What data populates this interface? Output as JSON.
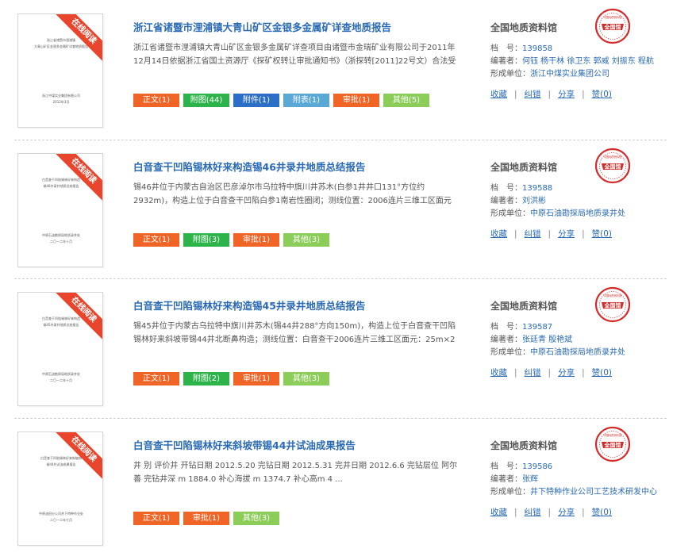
{
  "records": [
    {
      "title": "浙江省诸暨市浬浦镇大青山矿区金银多金属矿详查地质报告",
      "summary": "浙江省诸暨市浬浦镇大青山矿区金银多金属矿详查项目由诸暨市金瑞矿业有限公司于2011年12月14日依据浙江省国土资源厅《探矿权转让审批通知书》（浙探转[2011]22号文）合法受让，勘查单位为浙江中 ...",
      "ribbon": "在线阅读",
      "thumb_lines": [
        "浙江省诸暨市浬浦镇",
        "大青山矿区金银多金属矿详查地质报告"
      ],
      "thumb_footer": [
        "浙江中煤实业集团有限公司",
        "2012年3月"
      ],
      "tags": [
        {
          "label": "正文(1)",
          "color": "#f06525"
        },
        {
          "label": "附图(44)",
          "color": "#2cb34a"
        },
        {
          "label": "附件(1)",
          "color": "#2c6fc6"
        },
        {
          "label": "附表(1)",
          "color": "#5aa8d6"
        },
        {
          "label": "审批(1)",
          "color": "#f06525"
        },
        {
          "label": "其他(5)",
          "color": "#8ccd5a"
        }
      ],
      "org": "全国地质资料馆",
      "archive_label": "档　号：",
      "archive_no": "139858",
      "authors_label": "编著者：",
      "authors": "何钰 杨干林 徐卫东 郭威 刘振东 程航",
      "unit_label": "形成单位：",
      "unit": "浙江中煤实业集团公司",
      "actions": [
        "收藏",
        "纠错",
        "分享",
        "赞(0)"
      ]
    },
    {
      "title": "白音查干凹陷锡林好来构造锡46井录井地质总结报告",
      "summary": "锡46井位于内蒙古自治区巴彦淖尔市乌拉特中旗川井苏木(白参1井井口131°方位约2932m)，构造上位于白音查干凹陷白参1南岩性圈闭；测线位置：2006连片三维工区面元25m×25 ...",
      "ribbon": "在线阅读",
      "thumb_lines": [
        "白音查干凹陷锡林好来构造",
        "锡46井录井地质总结报告"
      ],
      "thumb_footer": [
        "中原石油勘探局地质录井处",
        "二〇一二年十月"
      ],
      "tags": [
        {
          "label": "正文(1)",
          "color": "#f06525"
        },
        {
          "label": "附图(3)",
          "color": "#2cb34a"
        },
        {
          "label": "审批(1)",
          "color": "#f06525"
        },
        {
          "label": "其他(3)",
          "color": "#8ccd5a"
        }
      ],
      "org": "全国地质资料馆",
      "archive_label": "档　号：",
      "archive_no": "139588",
      "authors_label": "编著者：",
      "authors": "刘洪彬",
      "unit_label": "形成单位：",
      "unit": "中原石油勘探局地质录井处",
      "actions": [
        "收藏",
        "纠错",
        "分享",
        "赞(0)"
      ]
    },
    {
      "title": "白音查干凹陷锡林好来构造锡45井录井地质总结报告",
      "summary": "锡45井位于内蒙古乌拉特中旗川井苏木(锡44井288°方向150m)，构造上位于白音查干凹陷锡林好来斜坡带锡44井北断鼻构造；测线位置：白音查干2006连片三维工区面元：25m×2 ...",
      "ribbon": "在线阅读",
      "thumb_lines": [
        "白音查干凹陷锡林好来构造",
        "锡45井录井地质总结报告"
      ],
      "thumb_footer": [
        "中原石油勘探局地质录井处",
        "二〇一二年十月"
      ],
      "tags": [
        {
          "label": "正文(1)",
          "color": "#f06525"
        },
        {
          "label": "附图(2)",
          "color": "#2cb34a"
        },
        {
          "label": "审批(1)",
          "color": "#f06525"
        },
        {
          "label": "其他(3)",
          "color": "#8ccd5a"
        }
      ],
      "org": "全国地质资料馆",
      "archive_label": "档　号：",
      "archive_no": "139587",
      "authors_label": "编著者：",
      "authors": "张廷青 殷艳斌",
      "unit_label": "形成单位：",
      "unit": "中原石油勘探局地质录井处",
      "actions": [
        "收藏",
        "纠错",
        "分享",
        "赞(0)"
      ]
    },
    {
      "title": "白音查干凹陷锡林好来斜坡带锡44井试油成果报告",
      "summary": "井 别 评价井 开钻日期 2012.5.20 完钻日期 2012.5.31 完井日期 2012.6.6 完钻层位 阿尔善 完钻井深 m 1884.0 补心海拔 m 1374.7 补心高m 4 ...",
      "ribbon": "在线阅读",
      "thumb_lines": [
        "白音查干凹陷锡林好来斜坡带",
        "锡44井试油成果报告"
      ],
      "thumb_footer": [
        "中原油田分公司井下特种作业处",
        "二〇一二年七月"
      ],
      "tags": [
        {
          "label": "正文(1)",
          "color": "#f06525"
        },
        {
          "label": "审批(1)",
          "color": "#f06525"
        },
        {
          "label": "其他(3)",
          "color": "#8ccd5a"
        }
      ],
      "org": "全国地质资料馆",
      "archive_label": "档　号：",
      "archive_no": "139586",
      "authors_label": "编著者：",
      "authors": "张辉",
      "unit_label": "形成单位：",
      "unit": "井下特种作业公司工艺技术研发中心",
      "actions": [
        "收藏",
        "纠错",
        "分享",
        "赞(0)"
      ]
    }
  ],
  "seal": {
    "text": "全国馆",
    "ring_text": "中国地质资料馆",
    "color": "#d42a2a"
  }
}
